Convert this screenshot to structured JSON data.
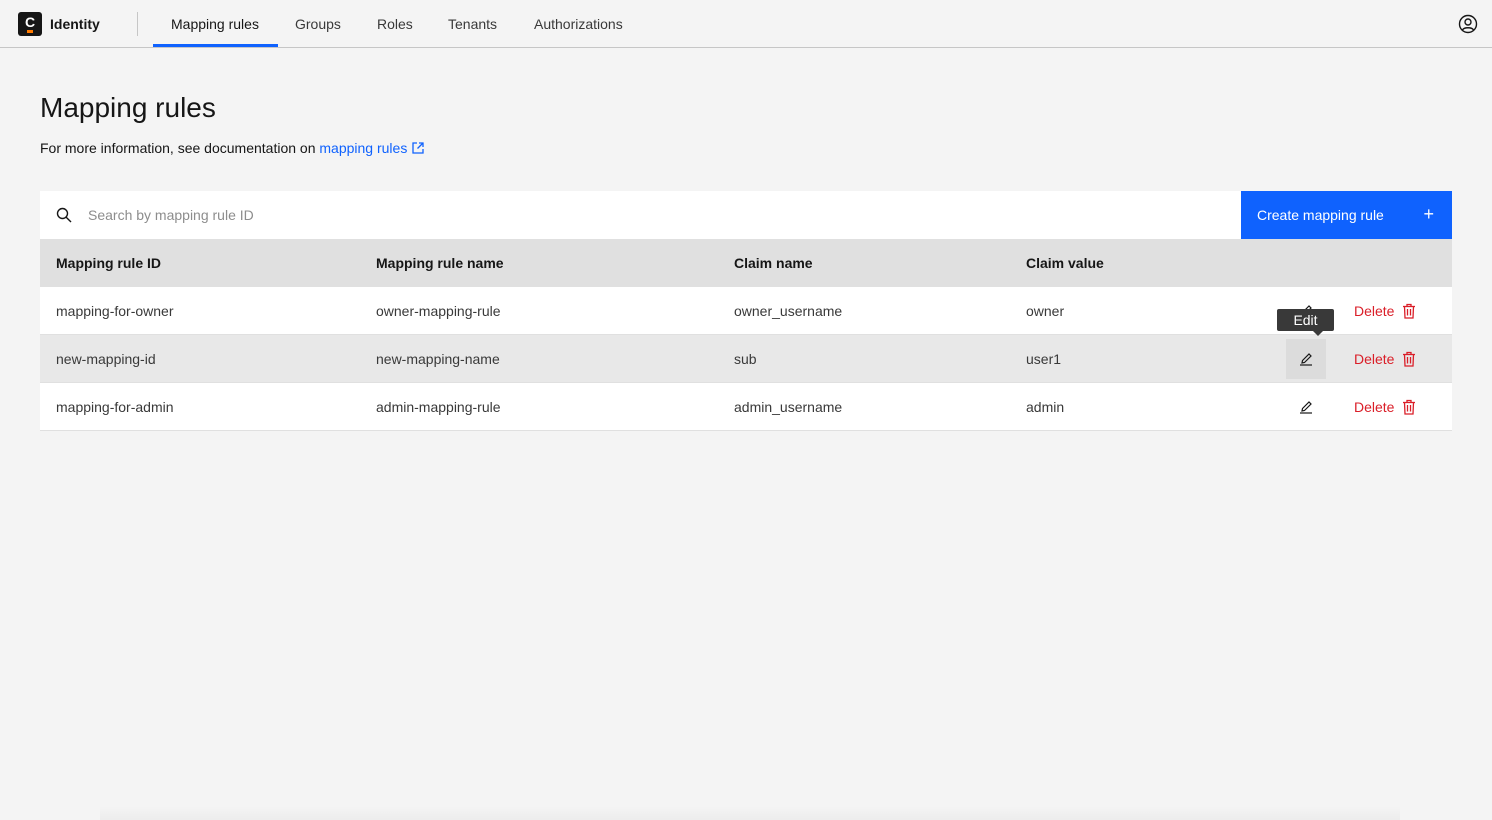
{
  "header": {
    "logo_letter": "C",
    "brand": "Identity",
    "nav": [
      {
        "label": "Mapping rules",
        "active": true
      },
      {
        "label": "Groups",
        "active": false
      },
      {
        "label": "Roles",
        "active": false
      },
      {
        "label": "Tenants",
        "active": false
      },
      {
        "label": "Authorizations",
        "active": false
      }
    ],
    "user_icon": "user-avatar-icon"
  },
  "page": {
    "title": "Mapping rules",
    "info_prefix": "For more information, see documentation on ",
    "info_link": "mapping rules"
  },
  "toolbar": {
    "search_placeholder": "Search by mapping rule ID",
    "create_label": "Create mapping rule",
    "create_icon": "+"
  },
  "table": {
    "columns": [
      "Mapping rule ID",
      "Mapping rule name",
      "Claim name",
      "Claim value"
    ],
    "rows": [
      {
        "id": "mapping-for-owner",
        "name": "owner-mapping-rule",
        "claim_name": "owner_username",
        "claim_value": "owner"
      },
      {
        "id": "new-mapping-id",
        "name": "new-mapping-name",
        "claim_name": "sub",
        "claim_value": "user1"
      },
      {
        "id": "mapping-for-admin",
        "name": "admin-mapping-rule",
        "claim_name": "admin_username",
        "claim_value": "admin"
      }
    ],
    "delete_label": "Delete",
    "edit_tooltip": "Edit"
  },
  "colors": {
    "primary": "#0f62fe",
    "danger": "#da1e28",
    "background": "#f4f4f4"
  }
}
